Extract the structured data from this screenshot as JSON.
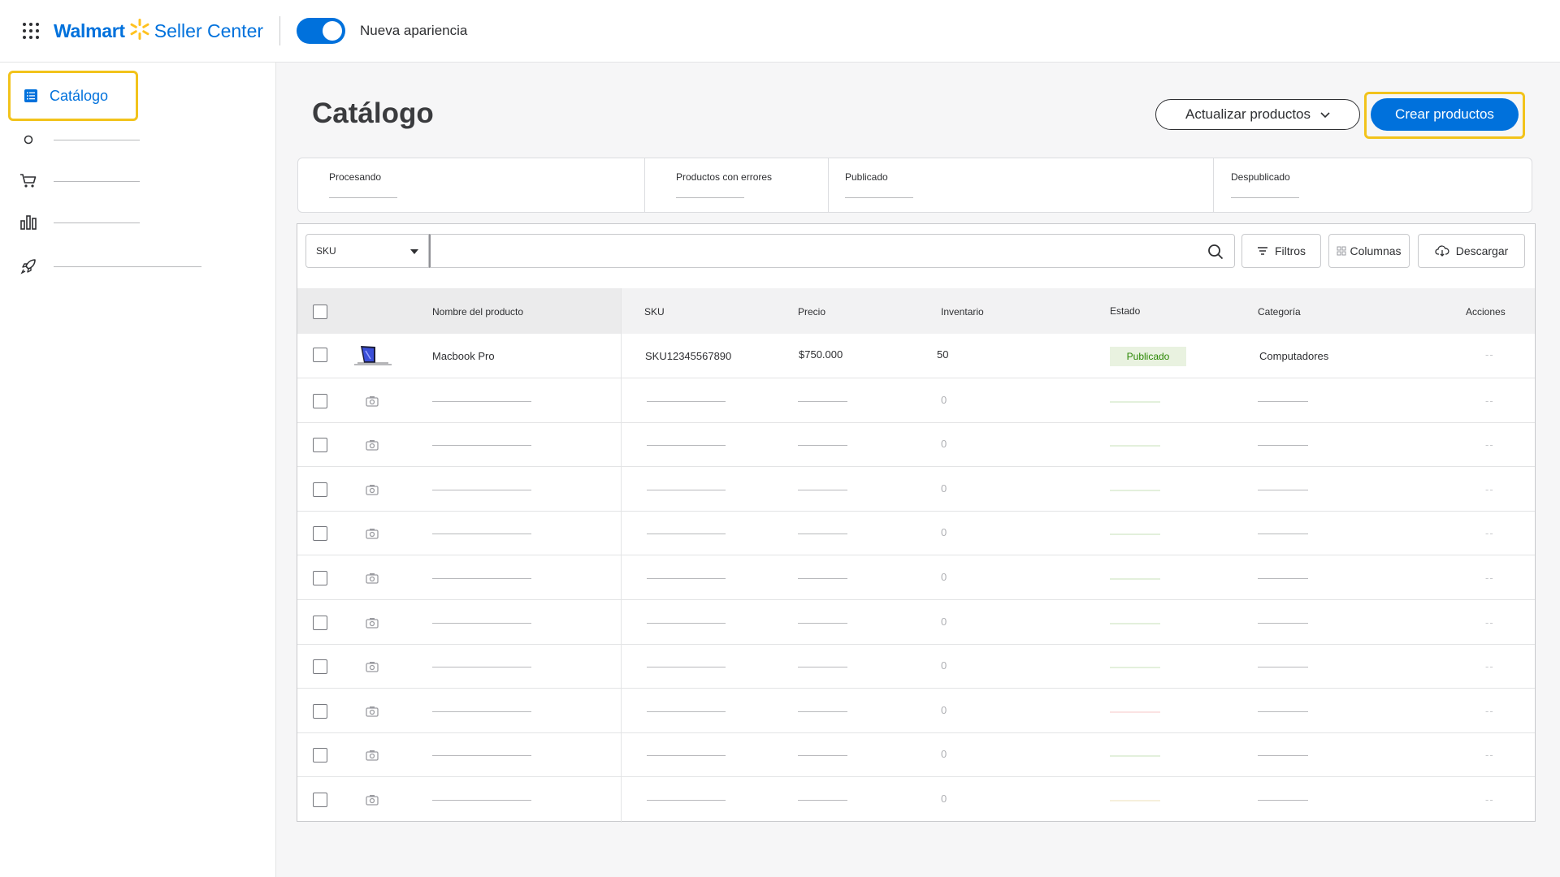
{
  "header": {
    "brand": "Walmart",
    "product": "Seller Center",
    "toggle_label": "Nueva apariencia",
    "toggle_on": true,
    "colors": {
      "brand_blue": "#0071dc",
      "spark_yellow": "#ffc220"
    }
  },
  "sidebar": {
    "active_item": {
      "label": "Catálogo",
      "icon": "list-icon"
    },
    "placeholder_items": [
      {
        "icon": "circle-icon"
      },
      {
        "icon": "cart-icon"
      },
      {
        "icon": "bar-chart-icon"
      },
      {
        "icon": "rocket-icon"
      }
    ]
  },
  "page": {
    "title": "Catálogo",
    "update_button": "Actualizar productos",
    "create_button": "Crear productos"
  },
  "stats": [
    {
      "label": "Procesando"
    },
    {
      "label": "Productos con errores"
    },
    {
      "label": "Publicado"
    },
    {
      "label": "Despublicado"
    }
  ],
  "toolbar": {
    "search_field": "SKU",
    "search_value": "",
    "filters_button": "Filtros",
    "columns_button": "Columnas",
    "download_button": "Descargar"
  },
  "table": {
    "columns": [
      "Nombre del producto",
      "SKU",
      "Precio",
      "Inventario",
      "Estado",
      "Categoría",
      "Acciones"
    ],
    "rows": [
      {
        "name": "Macbook Pro",
        "sku": "SKU12345567890",
        "price": "$750.000",
        "inventory": "50",
        "status": "Publicado",
        "category": "Computadores",
        "actions": "--"
      }
    ],
    "placeholder_row": {
      "inventory": "0",
      "actions": "--"
    },
    "placeholder_row_count": 10,
    "placeholder_status_colors": [
      "#e3f0dc",
      "#e3f0dc",
      "#e3f0dc",
      "#e3f0dc",
      "#e3f0dc",
      "#e3f0dc",
      "#e3f0dc",
      "#fbe3e3",
      "#e3f0dc",
      "#f6f0dc"
    ]
  }
}
